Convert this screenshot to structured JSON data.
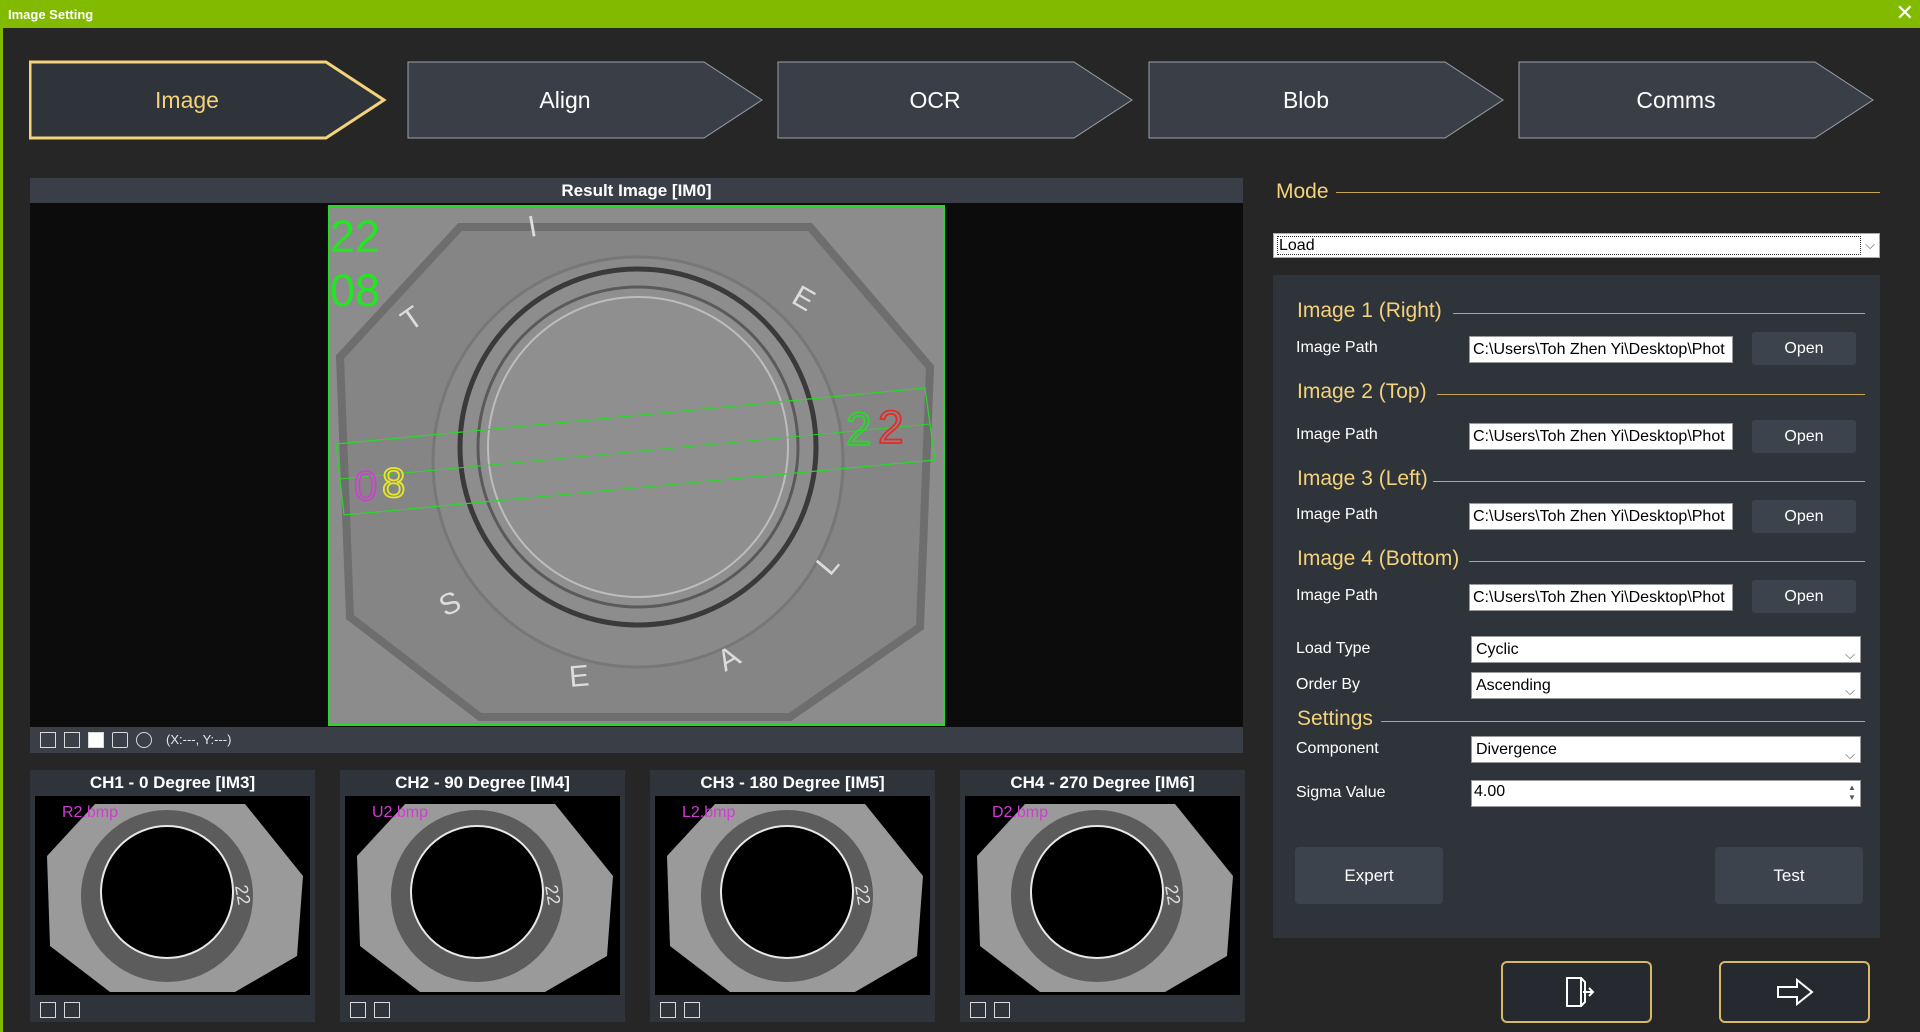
{
  "window": {
    "title": "Image Setting",
    "close_icon": "close-icon"
  },
  "steps": [
    {
      "label": "Image",
      "active": true
    },
    {
      "label": "Align",
      "active": false
    },
    {
      "label": "OCR",
      "active": false
    },
    {
      "label": "Blob",
      "active": false
    },
    {
      "label": "Comms",
      "active": false
    }
  ],
  "result": {
    "title": "Result Image  [IM0]",
    "coord": "(X:---, Y:---)",
    "ocr_top": "22",
    "ocr_bottom": "08",
    "ring_letters": [
      "T",
      "I",
      "E",
      "S",
      "E",
      "A",
      "L"
    ],
    "box_left_digits": [
      "0",
      "8"
    ],
    "box_right_digits": [
      "2",
      "2"
    ]
  },
  "channels": [
    {
      "title": "CH1 - 0 Degree  [IM3]",
      "file": "R2.bmp"
    },
    {
      "title": "CH2 - 90 Degree  [IM4]",
      "file": "U2.bmp"
    },
    {
      "title": "CH3 - 180 Degree  [IM5]",
      "file": "L2.bmp"
    },
    {
      "title": "CH4 - 270 Degree  [IM6]",
      "file": "D2.bmp"
    }
  ],
  "channel_ring_text": "22",
  "mode": {
    "label": "Mode",
    "value": "Load"
  },
  "images": [
    {
      "title": "Image 1 (Right)",
      "path_label": "Image Path",
      "path": "C:\\Users\\Toh Zhen Yi\\Desktop\\Phot",
      "open": "Open"
    },
    {
      "title": "Image 2 (Top)",
      "path_label": "Image Path",
      "path": "C:\\Users\\Toh Zhen Yi\\Desktop\\Phot",
      "open": "Open"
    },
    {
      "title": "Image 3 (Left)",
      "path_label": "Image Path",
      "path": "C:\\Users\\Toh Zhen Yi\\Desktop\\Phot",
      "open": "Open"
    },
    {
      "title": "Image 4 (Bottom)",
      "path_label": "Image Path",
      "path": "C:\\Users\\Toh Zhen Yi\\Desktop\\Phot",
      "open": "Open"
    }
  ],
  "load_type": {
    "label": "Load Type",
    "value": "Cyclic"
  },
  "order_by": {
    "label": "Order By",
    "value": "Ascending"
  },
  "settings": {
    "title": "Settings",
    "component_label": "Component",
    "component_value": "Divergence",
    "sigma_label": "Sigma Value",
    "sigma_value": "4.00"
  },
  "buttons": {
    "expert": "Expert",
    "test": "Test"
  },
  "nav": {
    "exit_icon": "exit-door-icon",
    "next_icon": "arrow-right-icon"
  }
}
